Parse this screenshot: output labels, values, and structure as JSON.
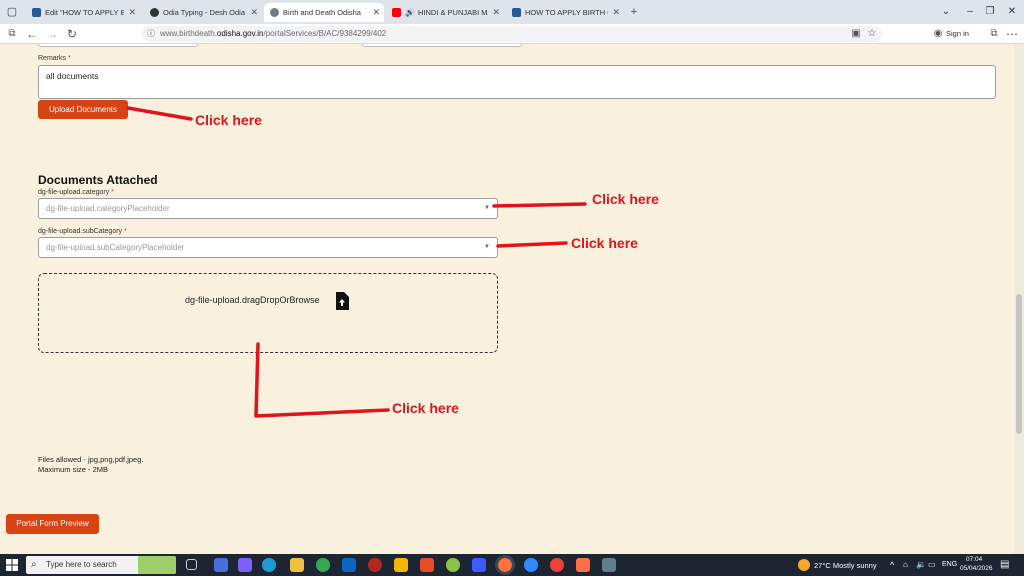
{
  "browser": {
    "tabs": [
      {
        "title": "Edit \"HOW TO APPLY BIRTH CE",
        "favicon_color": "#2b5797"
      },
      {
        "title": "Odia Typing - Desh Odia Keyb",
        "favicon_color": "#333333"
      },
      {
        "title": "Birth and Death Odisha",
        "favicon_color": "#6c7a89"
      },
      {
        "title": "HINDI & PUNJABI MASHUP",
        "favicon_color": "#ff0000"
      },
      {
        "title": "HOW TO APPLY BIRTH CRTIFICA",
        "favicon_color": "#2b5797"
      }
    ],
    "active_tab": 2,
    "url_prefix": "www.birthdeath.",
    "url_domain": "odisha.gov.in",
    "url_path": "/portalServices/B/AC/9384299/402",
    "signin_label": "Sign in"
  },
  "form": {
    "remarks_label": "Remarks",
    "required_mark": "*",
    "remarks_value": "all documents",
    "upload_button": "Upload Documents",
    "section_title": "Documents Attached",
    "category_label": "dg-file-upload.category",
    "category_placeholder": "dg-file-upload.categoryPlaceholder",
    "subcategory_label": "dg-file-upload.subCategory",
    "subcategory_placeholder": "dg-file-upload.subCategoryPlaceholder",
    "dropzone_text": "dg-file-upload.dragDropOrBrowse",
    "files_allowed": "Files allowed - jpg,png,pdf,jpeg.",
    "max_size": "Maximum size - 2MB",
    "preview_button": "Portal Form Preview"
  },
  "annotations": {
    "click_here": "Click here",
    "color": "#e0141b"
  },
  "taskbar": {
    "search_placeholder": "Type here to search",
    "weather": "27°C  Mostly sunny",
    "language": "ENG",
    "time": "07:04",
    "date": "05/04/2026"
  },
  "colors": {
    "page_bg": "#f9f1de",
    "accent": "#d94314"
  }
}
